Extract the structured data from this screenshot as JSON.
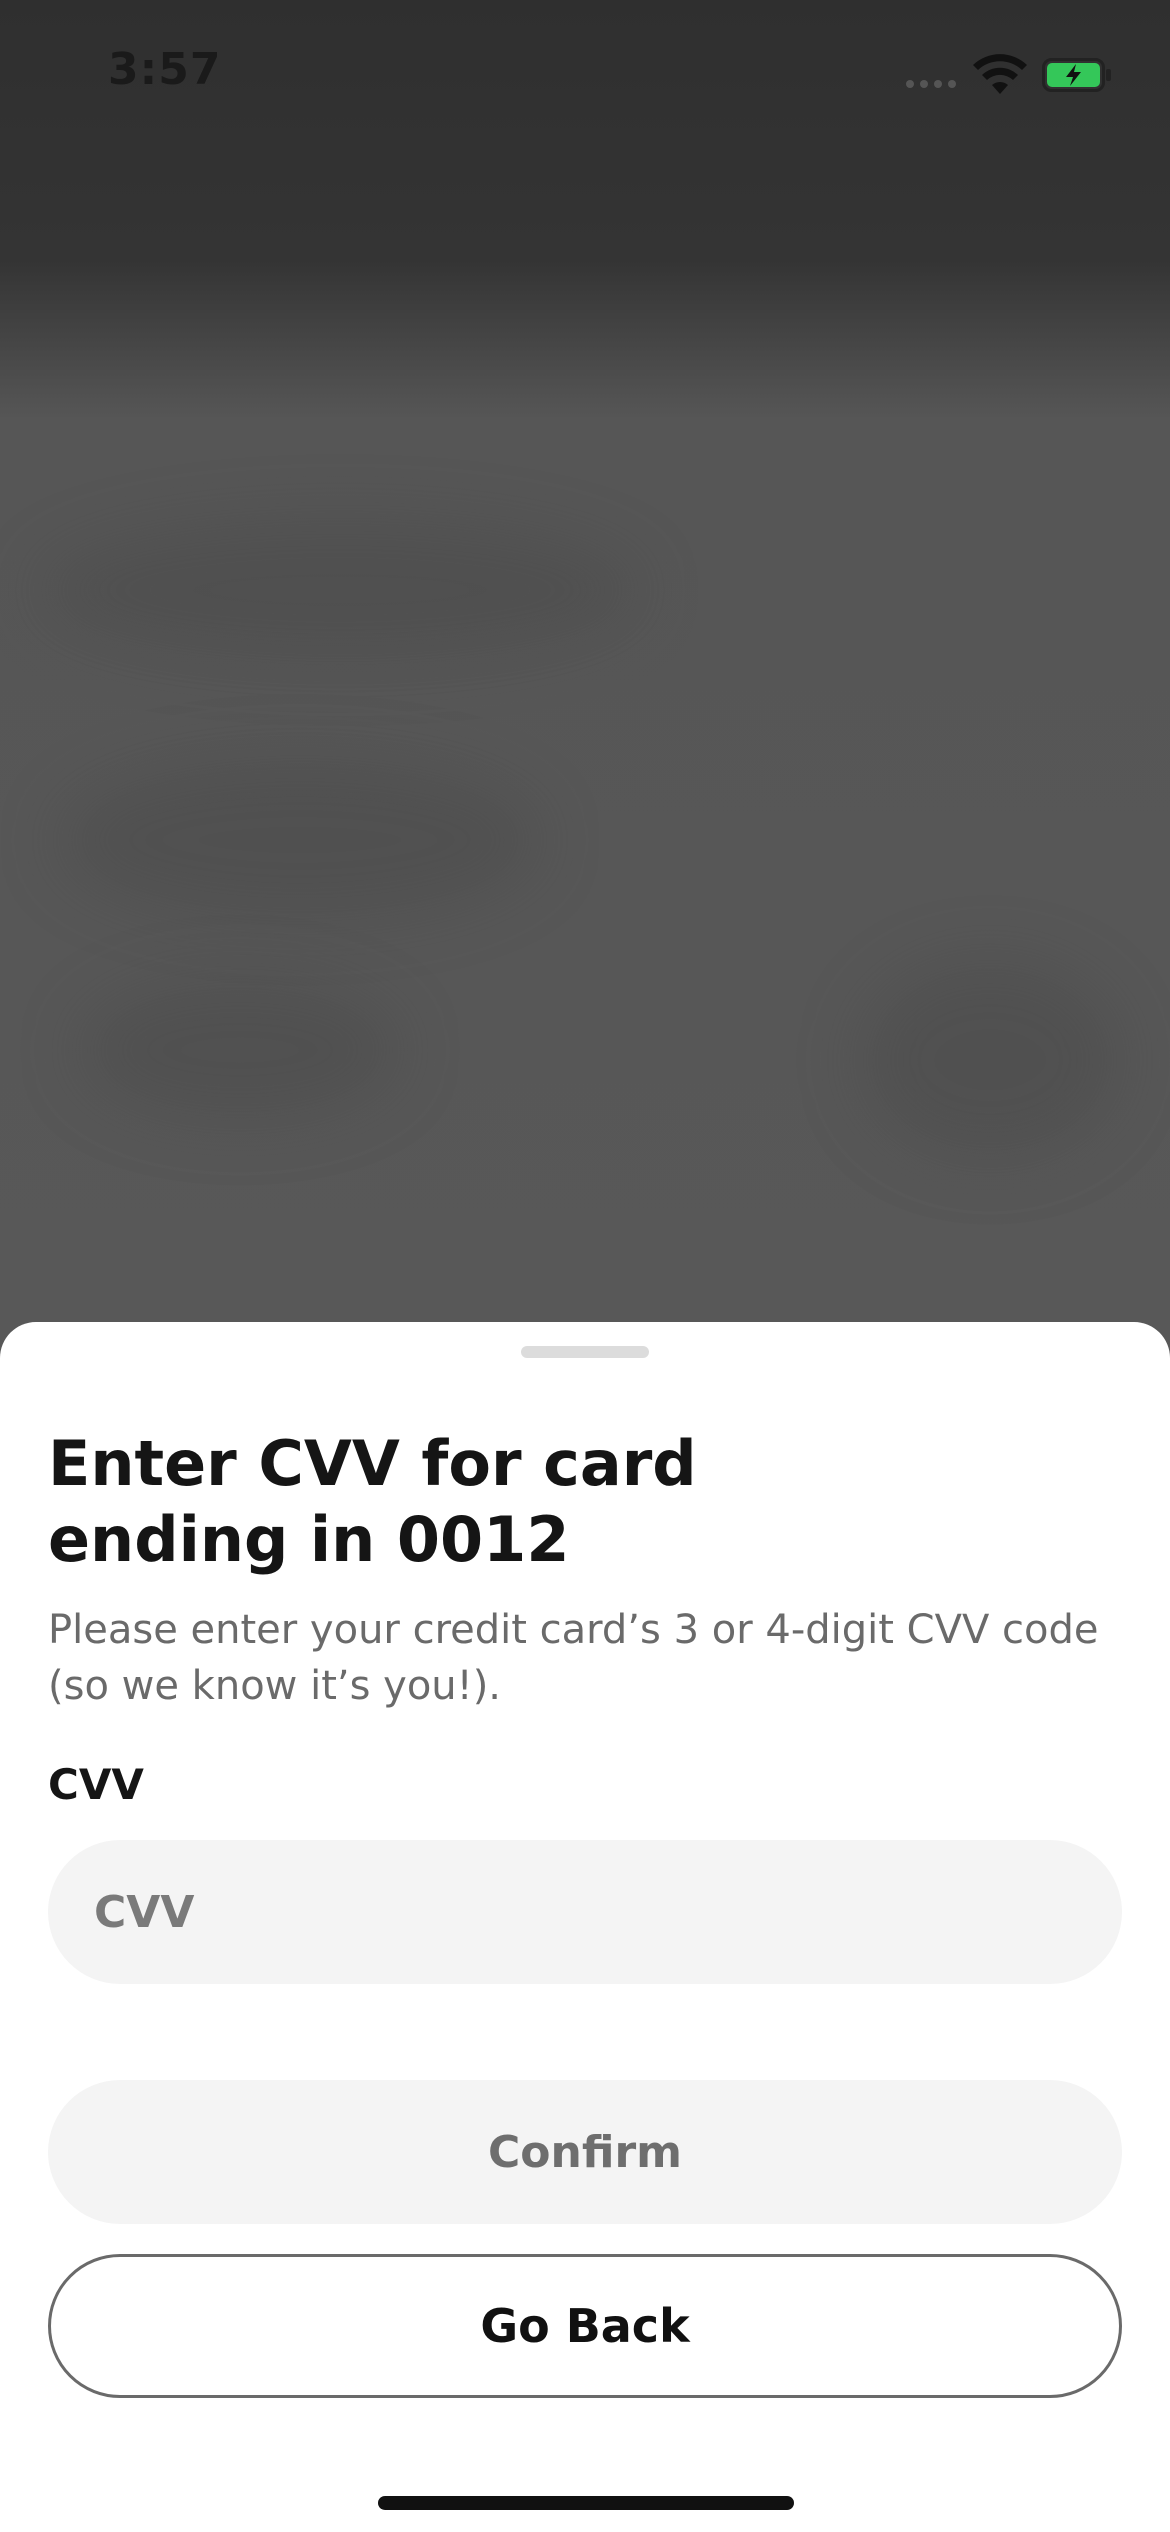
{
  "status_bar": {
    "time": "3:57",
    "icons": [
      "signal-icon",
      "wifi-icon",
      "battery-charging-icon"
    ],
    "battery_color": "#34c759"
  },
  "sheet": {
    "title": "Enter CVV for card ending in 0012",
    "subtitle": "Please enter your credit card’s 3 or 4-digit CVV code (so we know it’s you!).",
    "cvv_label": "CVV",
    "cvv_input": {
      "value": "",
      "placeholder": "CVV"
    },
    "confirm_label": "Confirm",
    "go_back_label": "Go Back"
  },
  "colors": {
    "sheet_background": "#ffffff",
    "input_background": "#f4f4f4",
    "text_primary": "#151515",
    "text_secondary": "#6a6a6a"
  }
}
